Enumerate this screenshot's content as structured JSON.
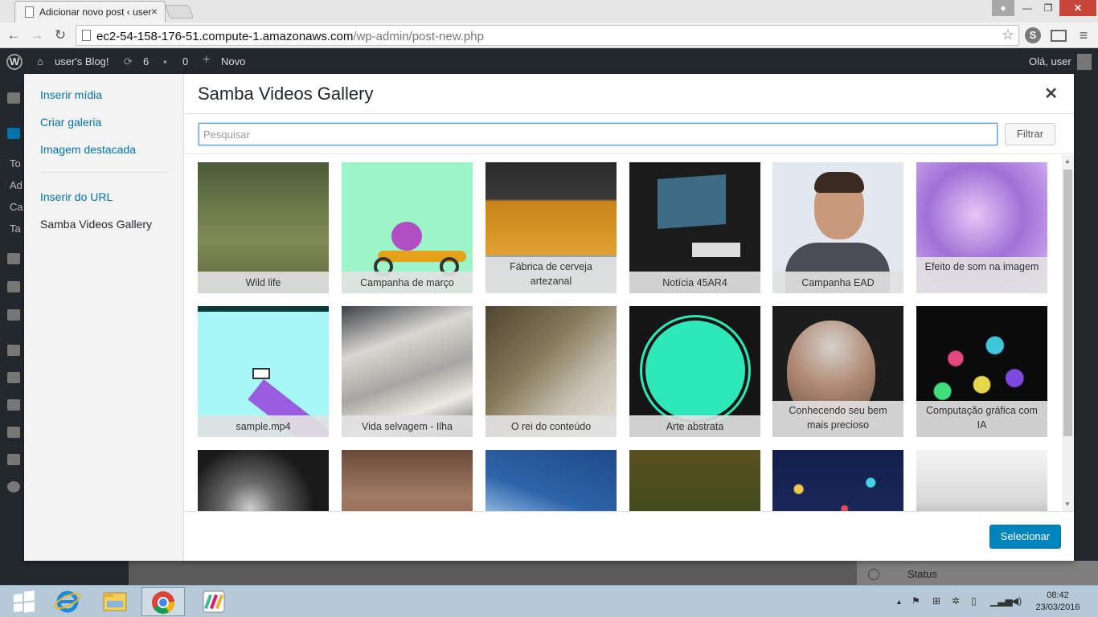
{
  "browser": {
    "tab_title": "Adicionar novo post ‹ user",
    "url_host": "ec2-54-158-176-51.compute-1.amazonaws.com",
    "url_path": "/wp-admin/post-new.php"
  },
  "adminbar": {
    "site_name": "user's Blog!",
    "updates_count": "6",
    "comments_count": "0",
    "new_label": "Novo",
    "greeting": "Olá, user"
  },
  "backdrop": {
    "sidebar_items": [
      "To",
      "Ad",
      "Ca",
      "Ta"
    ],
    "status_label": "Status"
  },
  "modal": {
    "menu": {
      "insert_media": "Inserir mídia",
      "create_gallery": "Criar galeria",
      "featured_image": "Imagem destacada",
      "insert_from_url": "Inserir do URL",
      "samba_gallery": "Samba Videos Gallery"
    },
    "title": "Samba Videos Gallery",
    "search_placeholder": "Pesquisar",
    "filter_label": "Filtrar",
    "select_label": "Selecionar",
    "videos": [
      {
        "title": "Wild life"
      },
      {
        "title": "Campanha de março"
      },
      {
        "title": "Fábrica de cerveja artezanal"
      },
      {
        "title": "Notícia 45AR4"
      },
      {
        "title": "Campanha EAD"
      },
      {
        "title": "Efeito de som na imagem"
      },
      {
        "title": "sample.mp4"
      },
      {
        "title": "Vida selvagem - Ilha"
      },
      {
        "title": "O rei do conteúdo"
      },
      {
        "title": "Arte abstrata"
      },
      {
        "title": "Conhecendo seu bem mais precioso"
      },
      {
        "title": "Computação gráfica com IA"
      },
      {
        "title": ""
      },
      {
        "title": ""
      },
      {
        "title": ""
      },
      {
        "title": ""
      },
      {
        "title": ""
      },
      {
        "title": ""
      }
    ]
  },
  "taskbar": {
    "time": "08:42",
    "date": "23/03/2016"
  }
}
